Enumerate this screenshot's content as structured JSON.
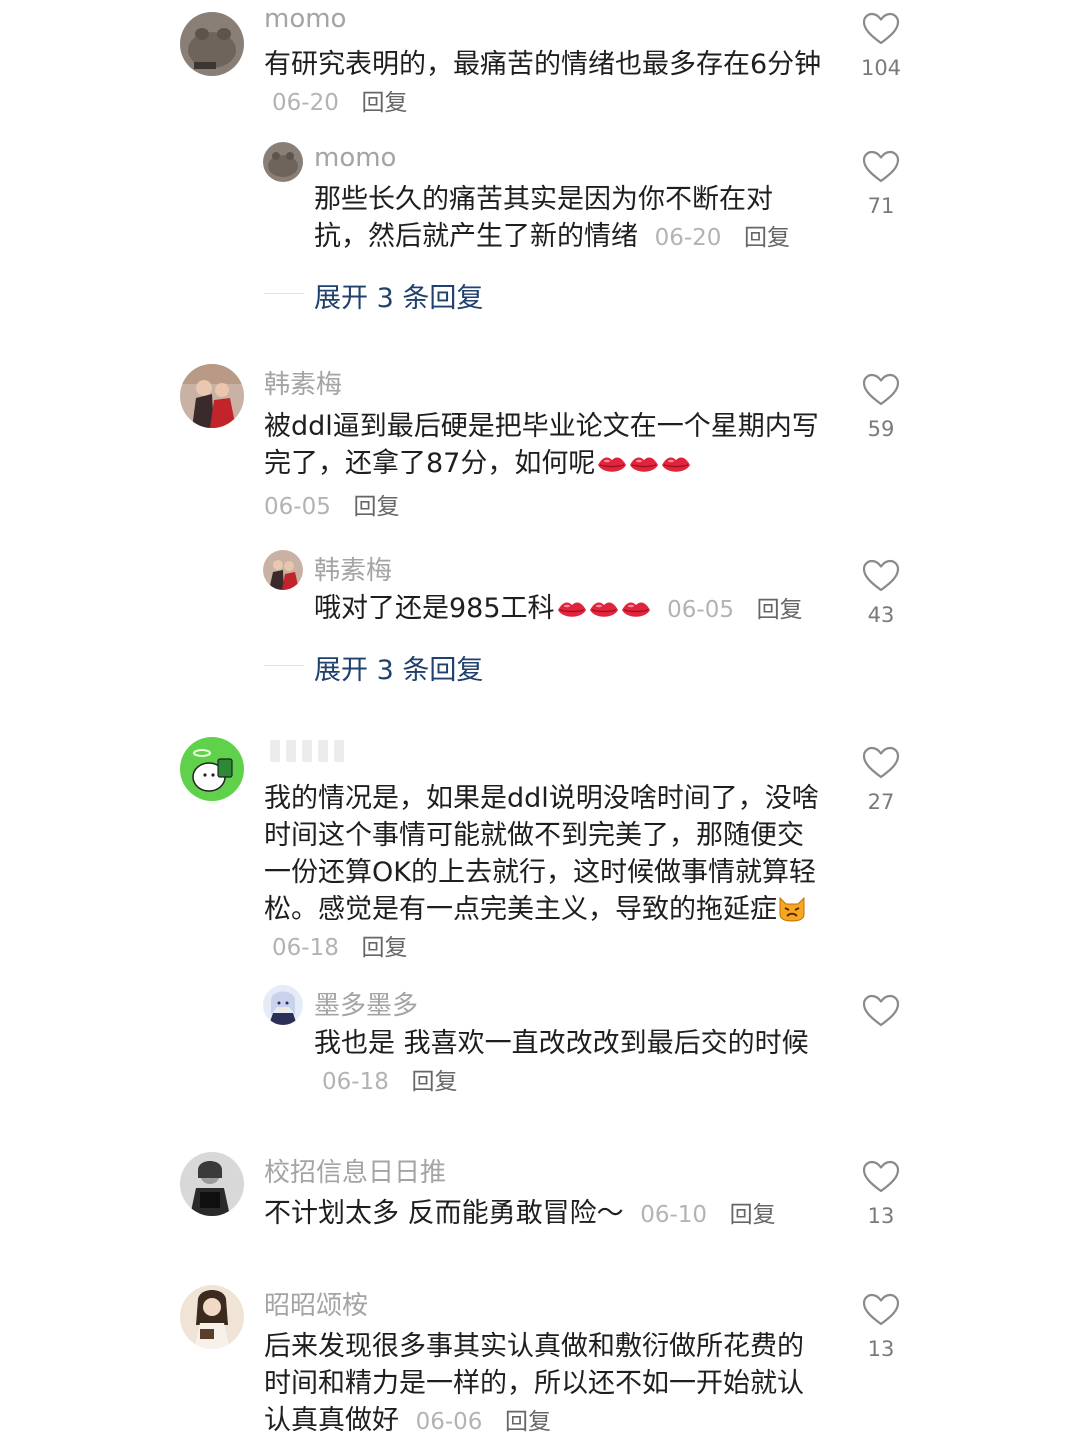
{
  "comments": [
    {
      "author": "momo",
      "text": "有研究表明的，最痛苦的情绪也最多存在6分钟",
      "date": "06-20",
      "reply_label": "回复",
      "likes": "104",
      "replies": [
        {
          "author": "momo",
          "text": "那些长久的痛苦其实是因为你不断在对抗，然后就产生了新的情绪",
          "date": "06-20",
          "reply_label": "回复",
          "likes": "71"
        }
      ],
      "expand_label": "展开 3 条回复"
    },
    {
      "author": "韩素梅",
      "text": "被ddl逼到最后硬是把毕业论文在一个星期内写完了，还拿了87分，如何呢",
      "emoji": "lips",
      "date": "06-05",
      "reply_label": "回复",
      "likes": "59",
      "replies": [
        {
          "author": "韩素梅",
          "text": "哦对了还是985工科",
          "emoji": "lips",
          "date": "06-05",
          "reply_label": "回复",
          "likes": "43"
        }
      ],
      "expand_label": "展开 3 条回复"
    },
    {
      "author": "",
      "text": "我的情况是，如果是ddl说明没啥时间了，没啥时间这个事情可能就做不到完美了，那随便交一份还算OK的上去就行，这时候做事情就算轻松。感觉是有一点完美主义，导致的拖延症",
      "emoji": "cat-face",
      "date": "06-18",
      "reply_label": "回复",
      "likes": "27",
      "replies": [
        {
          "author": "墨多墨多",
          "text": "我也是 我喜欢一直改改改到最后交的时候",
          "date": "06-18",
          "reply_label": "回复",
          "likes": ""
        }
      ]
    },
    {
      "author": "校招信息日日推",
      "text": "不计划太多 反而能勇敢冒险～",
      "date": "06-10",
      "reply_label": "回复",
      "likes": "13"
    },
    {
      "author": "昭昭颂桉",
      "text": "后来发现很多事其实认真做和敷衍做所花费的时间和精力是一样的，所以还不如一开始就认认真真做好",
      "date": "06-06",
      "reply_label": "回复",
      "likes": "13"
    }
  ],
  "icons": {
    "like": "heart-outline-icon"
  },
  "colors": {
    "like_count": "#7a7a7a",
    "expand_link": "#20406e",
    "meta": "#b3b3b3",
    "author": "#a4a4a4"
  }
}
